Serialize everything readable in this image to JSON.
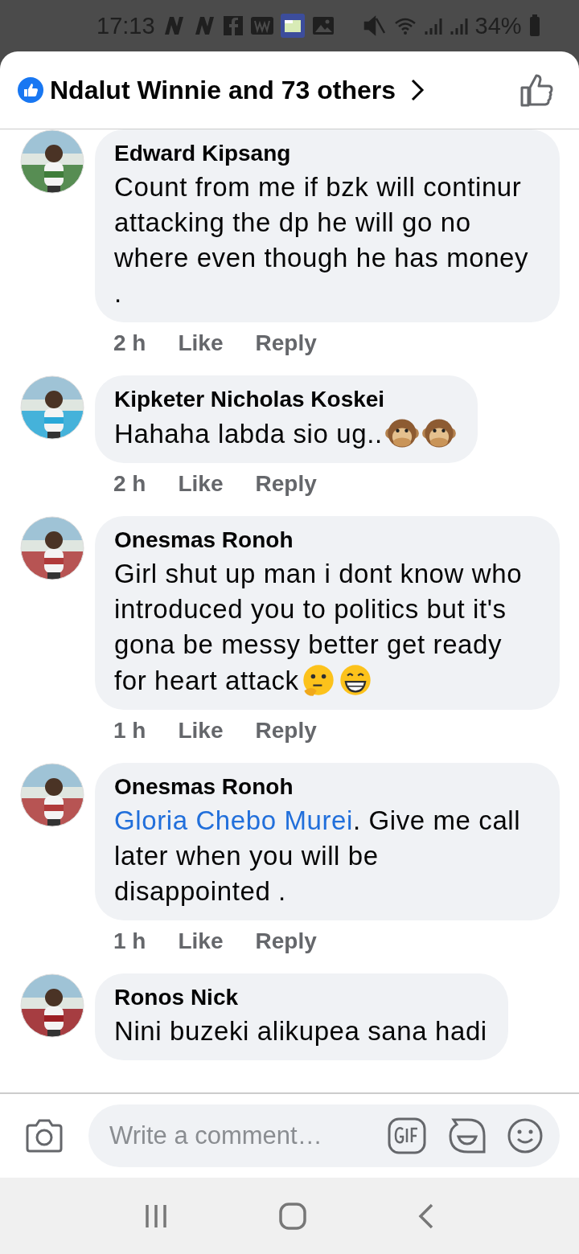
{
  "status_bar": {
    "time": "17:13",
    "battery": "34%"
  },
  "header": {
    "title": "Ndalut Winnie and 73 others"
  },
  "comments": [
    {
      "author": "Edward Kipsang",
      "text": "Count from me if bzk will continur attacking the dp he will go no where even though he has money .",
      "time": "2 h",
      "like": "Like",
      "reply": "Reply"
    },
    {
      "author": "Kipketer Nicholas Koskei",
      "text": "Hahaha labda sio ug..",
      "emojis": [
        {
          "kind": "monkey"
        },
        {
          "kind": "monkey"
        }
      ],
      "time": "2 h",
      "like": "Like",
      "reply": "Reply"
    },
    {
      "author": "Onesmas Ronoh",
      "text": "Girl shut up man i dont know who introduced you to politics but it's gona be messy better get ready for heart attack",
      "emojis": [
        {
          "kind": "thinking"
        },
        {
          "kind": "grin"
        }
      ],
      "time": "1 h",
      "like": "Like",
      "reply": "Reply"
    },
    {
      "author": "Onesmas Ronoh",
      "mention": "Gloria Chebo Murei",
      "text": ". Give me call later when you will be disappointed .",
      "time": "1 h",
      "like": "Like",
      "reply": "Reply"
    },
    {
      "author": "Ronos Nick",
      "text": "Nini buzeki alikupea sana hadi"
    }
  ],
  "composer": {
    "placeholder": "Write a comment…"
  }
}
